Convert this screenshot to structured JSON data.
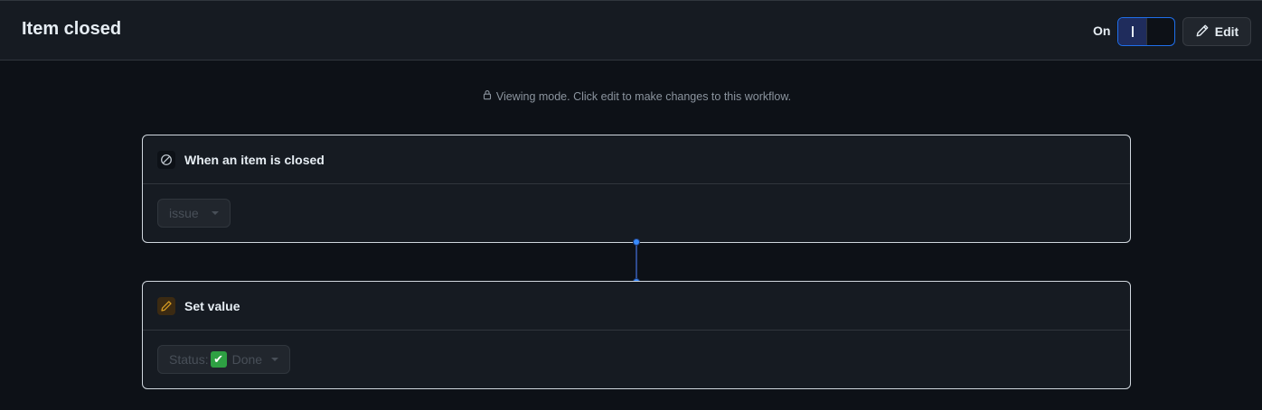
{
  "header": {
    "title": "Item closed",
    "on_label": "On",
    "edit_label": "Edit"
  },
  "notice": {
    "text": "Viewing mode. Click edit to make changes to this workflow."
  },
  "trigger_card": {
    "icon": "circle-slash-icon",
    "title": "When an item is closed",
    "select_value": "issue"
  },
  "action_card": {
    "icon": "pencil-icon",
    "title": "Set value",
    "select_prefix": "Status:",
    "select_emoji": "✔",
    "select_value": "Done"
  },
  "colors": {
    "background": "#0d1117",
    "header": "#161b22",
    "accent": "#1f6feb",
    "done_green": "#2ea043",
    "pencil_icon": "#d29922"
  }
}
